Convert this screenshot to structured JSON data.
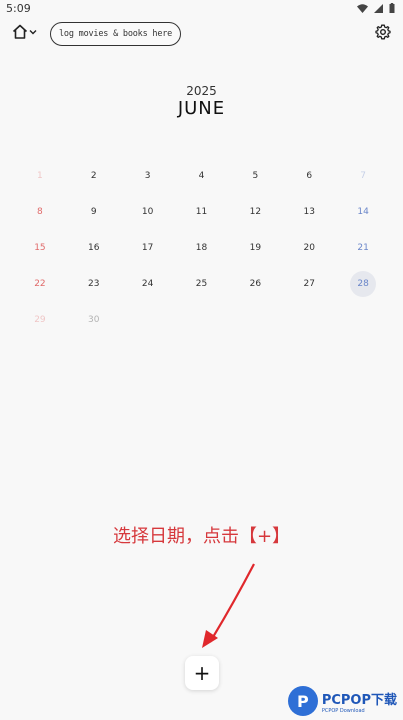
{
  "status": {
    "time": "5:09"
  },
  "header": {
    "tagline": "log movies & books here"
  },
  "calendar": {
    "year": "2025",
    "month": "JUNE",
    "weeks": [
      [
        "1",
        "2",
        "3",
        "4",
        "5",
        "6",
        "7"
      ],
      [
        "8",
        "9",
        "10",
        "11",
        "12",
        "13",
        "14"
      ],
      [
        "15",
        "16",
        "17",
        "18",
        "19",
        "20",
        "21"
      ],
      [
        "22",
        "23",
        "24",
        "25",
        "26",
        "27",
        "28"
      ],
      [
        "29",
        "30",
        "",
        "",
        "",
        "",
        ""
      ]
    ],
    "selected_day": "28"
  },
  "annotation": {
    "text": "选择日期，点击【+】"
  },
  "actions": {
    "add_label": "+"
  },
  "watermark": {
    "main": "PCPOP下载",
    "sub": "PCPOP Download"
  },
  "colors": {
    "sunday": "#e06a6a",
    "saturday": "#6a86c9",
    "annotation": "#d6383c"
  }
}
